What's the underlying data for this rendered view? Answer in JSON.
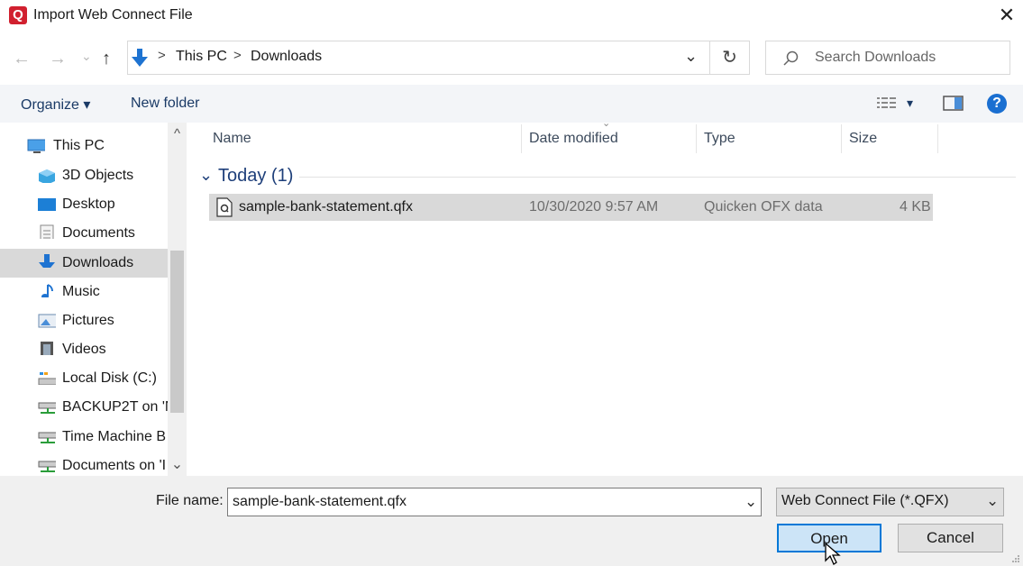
{
  "window": {
    "app_icon_letter": "Q",
    "title": "Import Web Connect File",
    "close_glyph": "✕"
  },
  "navigation": {
    "back_glyph": "←",
    "forward_glyph": "→",
    "recent_glyph": "⌄",
    "up_glyph": "↑",
    "breadcrumb": [
      "This PC",
      "Downloads"
    ],
    "separator": ">",
    "address_dropdown_glyph": "⌄",
    "refresh_glyph": "↻",
    "search_placeholder": "Search Downloads"
  },
  "command_bar": {
    "organize_label": "Organize",
    "organize_caret": "▾",
    "new_folder_label": "New folder",
    "view_caret": "▾",
    "help_label": "?"
  },
  "nav_pane": {
    "items": [
      {
        "label": "This PC",
        "icon": "this-pc-icon"
      },
      {
        "label": "3D Objects",
        "icon": "3d-objects-icon"
      },
      {
        "label": "Desktop",
        "icon": "desktop-icon"
      },
      {
        "label": "Documents",
        "icon": "documents-icon"
      },
      {
        "label": "Downloads",
        "icon": "downloads-icon",
        "selected": true
      },
      {
        "label": "Music",
        "icon": "music-icon"
      },
      {
        "label": "Pictures",
        "icon": "pictures-icon"
      },
      {
        "label": "Videos",
        "icon": "videos-icon"
      },
      {
        "label": "Local Disk (C:)",
        "icon": "local-disk-icon"
      },
      {
        "label": "BACKUP2T on 'N",
        "icon": "network-drive-icon"
      },
      {
        "label": "Time Machine B",
        "icon": "network-drive-icon"
      },
      {
        "label": "Documents on 'I",
        "icon": "network-drive-icon"
      }
    ],
    "scroll_up_glyph": "^",
    "scroll_down_glyph": "⌄"
  },
  "file_list": {
    "columns": [
      "Name",
      "Date modified",
      "Type",
      "Size"
    ],
    "group_label": "Today (1)",
    "group_chevron": "⌄",
    "rows": [
      {
        "name": "sample-bank-statement.qfx",
        "date_modified": "10/30/2020 9:57 AM",
        "type": "Quicken OFX data",
        "size": "4 KB"
      }
    ]
  },
  "footer": {
    "file_name_label": "File name:",
    "file_name_value": "sample-bank-statement.qfx",
    "file_name_dropdown_glyph": "⌄",
    "filter_value": "Web Connect File (*.QFX)",
    "filter_dropdown_glyph": "⌄",
    "open_label": "Open",
    "cancel_label": "Cancel"
  },
  "colors": {
    "accent": "#0078d7",
    "app_brand": "#d1202f",
    "selection": "#d9d9d9"
  }
}
